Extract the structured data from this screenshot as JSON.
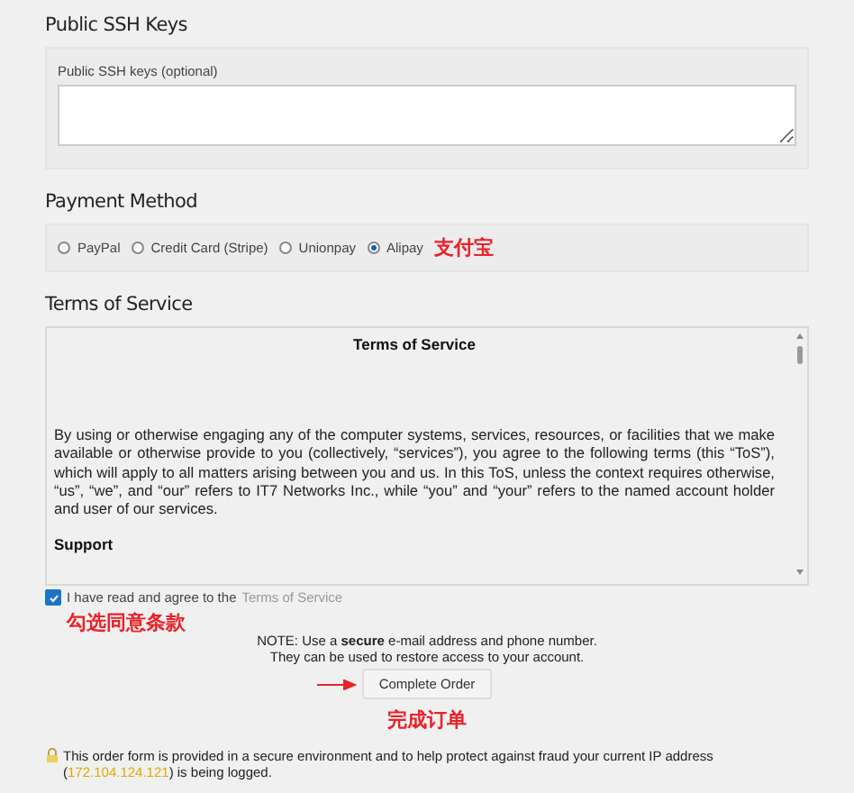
{
  "ssh_keys": {
    "heading": "Public SSH Keys",
    "field_label": "Public SSH keys (optional)"
  },
  "payment": {
    "heading": "Payment Method",
    "options": [
      {
        "label": "PayPal",
        "selected": false
      },
      {
        "label": "Credit Card (Stripe)",
        "selected": false
      },
      {
        "label": "Unionpay",
        "selected": false
      },
      {
        "label": "Alipay",
        "selected": true
      }
    ],
    "annotation": "支付宝"
  },
  "terms": {
    "heading": "Terms of Service",
    "box_title": "Terms of Service",
    "paragraph": "By using or otherwise engaging any of the computer systems, services, resources, or facilities that we make available or otherwise provide to you (collectively, “services”), you agree to the following terms (this “ToS”), which will apply to all matters arising between you and us. In this ToS, unless the context requires otherwise, “us”, “we”, and “our” refers to IT7 Networks Inc., while “you” and “your” refers to the named account holder and user of our services.",
    "next_heading": "Support",
    "agree_text": "I have read and agree to the",
    "agree_link": "Terms of Service",
    "agreed": true,
    "annotation": "勾选同意条款"
  },
  "note": [
    "NOTE: Use a **secure** e-mail address and phone number.",
    "They can be used to restore access to your account."
  ],
  "submit": {
    "label": "Complete Order",
    "annotation": "完成订单"
  },
  "footer": {
    "text_before": "This order form is provided in a secure environment and to help protect against fraud your current IP address (",
    "ip": "172.104.124.121",
    "text_after": ") is being logged."
  }
}
